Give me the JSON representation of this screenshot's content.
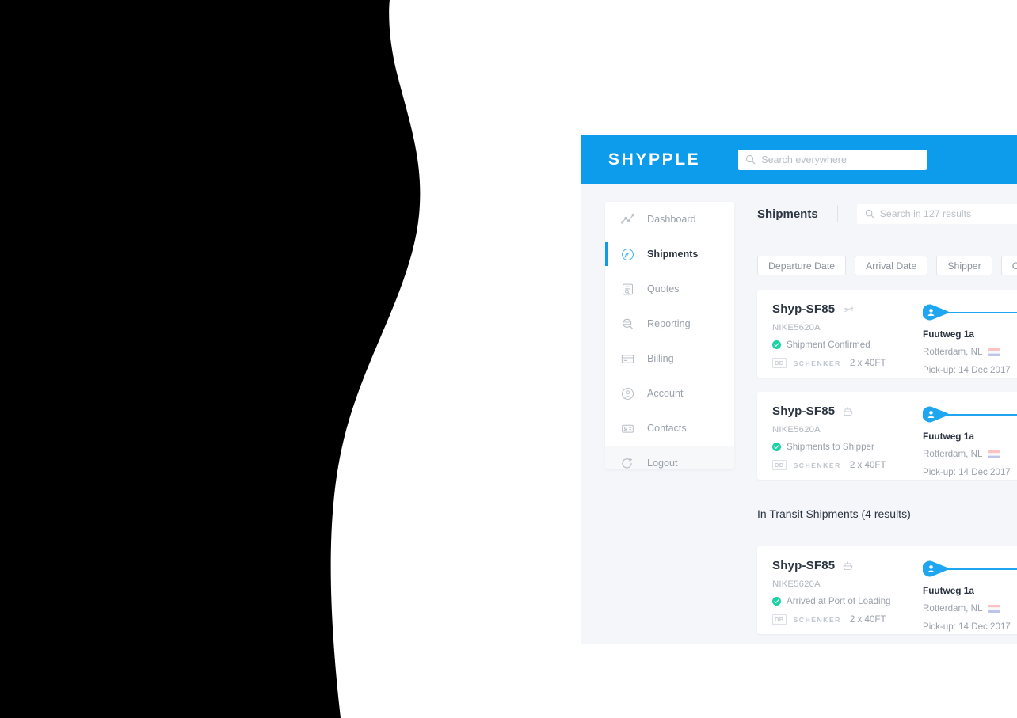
{
  "brand": {
    "name": "SHYPPLE"
  },
  "global_search": {
    "placeholder": "Search everywhere",
    "icon": "search-icon"
  },
  "sidebar": {
    "items": [
      {
        "label": "Dashboard",
        "icon": "chart-line-icon",
        "active": false
      },
      {
        "label": "Shipments",
        "icon": "compass-navigation-icon",
        "active": true
      },
      {
        "label": "Quotes",
        "icon": "document-search-icon",
        "active": false
      },
      {
        "label": "Reporting",
        "icon": "report-magnifier-icon",
        "active": false
      },
      {
        "label": "Billing",
        "icon": "credit-card-icon",
        "active": false
      },
      {
        "label": "Account",
        "icon": "user-circle-icon",
        "active": false
      },
      {
        "label": "Contacts",
        "icon": "contact-card-icon",
        "active": false
      },
      {
        "label": "Logout",
        "icon": "logout-arrow-icon",
        "active": false
      }
    ]
  },
  "main": {
    "title": "Shipments",
    "list_search": {
      "placeholder": "Search in 127 results",
      "icon": "search-icon"
    },
    "filters": [
      {
        "label": "Departure Date"
      },
      {
        "label": "Arrival Date"
      },
      {
        "label": "Shipper"
      },
      {
        "label": "C"
      }
    ],
    "sections": [
      {
        "heading": null,
        "cards": [
          {
            "reference": "Shyp-SF85",
            "mode_icon": "airplane-icon",
            "booking_ref": "NIKE5620A",
            "status": "Shipment Confirmed",
            "status_icon": "check-circle-icon",
            "carrier_badge": "DB",
            "carrier_name": "SCHENKER",
            "containers": "2 x 40FT",
            "origin_place": "Fuutweg 1a",
            "origin_city": "Rotterdam, NL",
            "origin_flag": "nl-flag-icon",
            "pickup": "Pick-up: 14 Dec 2017",
            "progress": 12
          },
          {
            "reference": "Shyp-SF85",
            "mode_icon": "vessel-icon",
            "booking_ref": "NIKE5620A",
            "status": "Shipments to Shipper",
            "status_icon": "check-circle-icon",
            "carrier_badge": "DB",
            "carrier_name": "SCHENKER",
            "containers": "2 x 40FT",
            "origin_place": "Fuutweg 1a",
            "origin_city": "Rotterdam, NL",
            "origin_flag": "nl-flag-icon",
            "pickup": "Pick-up: 14 Dec 2017",
            "progress": 12
          }
        ]
      },
      {
        "heading": "In Transit Shipments (4 results)",
        "cards": [
          {
            "reference": "Shyp-SF85",
            "mode_icon": "vessel-icon",
            "booking_ref": "NIKE5620A",
            "status": "Arrived at Port of Loading",
            "status_icon": "check-circle-icon",
            "carrier_badge": "DB",
            "carrier_name": "SCHENKER",
            "containers": "2 x 40FT",
            "origin_place": "Fuutweg 1a",
            "origin_city": "Rotterdam, NL",
            "origin_flag": "nl-flag-icon",
            "pickup": "Pick-up: 14 Dec 2017",
            "progress": 12
          }
        ]
      }
    ]
  },
  "colors": {
    "brand_blue": "#0d9bec",
    "accent_blue": "#1ea7f0",
    "status_green": "#19d3a2",
    "page_bg": "#f4f6f9",
    "card_bg": "#ffffff",
    "text_dark": "#2b3442",
    "text_muted": "#9aa1ab",
    "decor_black": "#000000"
  }
}
